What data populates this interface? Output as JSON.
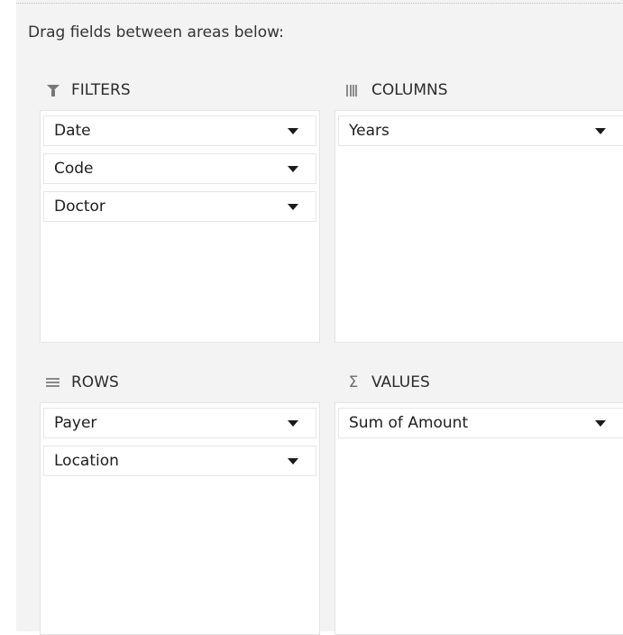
{
  "instruction": "Drag fields between areas below:",
  "areas": {
    "filters": {
      "title": "FILTERS",
      "icon": "filter-funnel-icon",
      "fields": [
        "Date",
        "Code",
        "Doctor"
      ]
    },
    "columns": {
      "title": "COLUMNS",
      "icon": "columns-icon",
      "fields": [
        "Years"
      ]
    },
    "rows": {
      "title": "ROWS",
      "icon": "rows-icon",
      "fields": [
        "Payer",
        "Location"
      ]
    },
    "values": {
      "title": "VALUES",
      "icon": "sigma-icon",
      "icon_glyph": "Σ",
      "fields": [
        "Sum of Amount"
      ]
    }
  },
  "colors": {
    "pane_background": "#f3f3f3",
    "area_background": "#ffffff",
    "text": "#1e1e1e"
  }
}
